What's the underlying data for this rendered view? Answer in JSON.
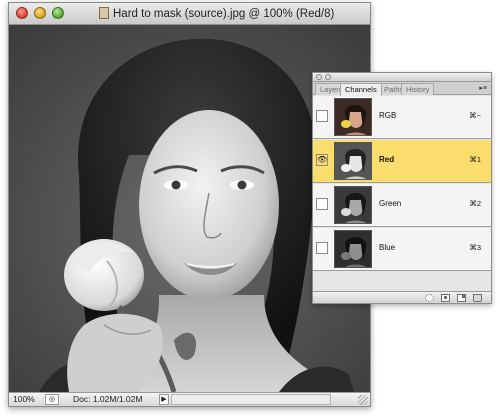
{
  "document": {
    "title": "Hard to mask (source).jpg @ 100% (Red/8)",
    "zoom": "100%",
    "doc_size": "Doc: 1.02M/1.02M"
  },
  "palette": {
    "tabs": [
      {
        "label": "Layers",
        "active": false
      },
      {
        "label": "Channels",
        "active": true
      },
      {
        "label": "Paths",
        "active": false
      },
      {
        "label": "History",
        "active": false
      }
    ],
    "channels": [
      {
        "name": "RGB",
        "shortcut": "⌘~",
        "selected": false,
        "visible": false
      },
      {
        "name": "Red",
        "shortcut": "⌘1",
        "selected": true,
        "visible": true
      },
      {
        "name": "Green",
        "shortcut": "⌘2",
        "selected": false,
        "visible": false
      },
      {
        "name": "Blue",
        "shortcut": "⌘3",
        "selected": false,
        "visible": false
      }
    ],
    "footer_buttons": [
      "load-selection-icon",
      "save-selection-icon",
      "new-channel-icon",
      "delete-channel-icon"
    ]
  },
  "colors": {
    "selected_row": "#fbdd6e",
    "canvas_bg": "#4b4b4b"
  }
}
